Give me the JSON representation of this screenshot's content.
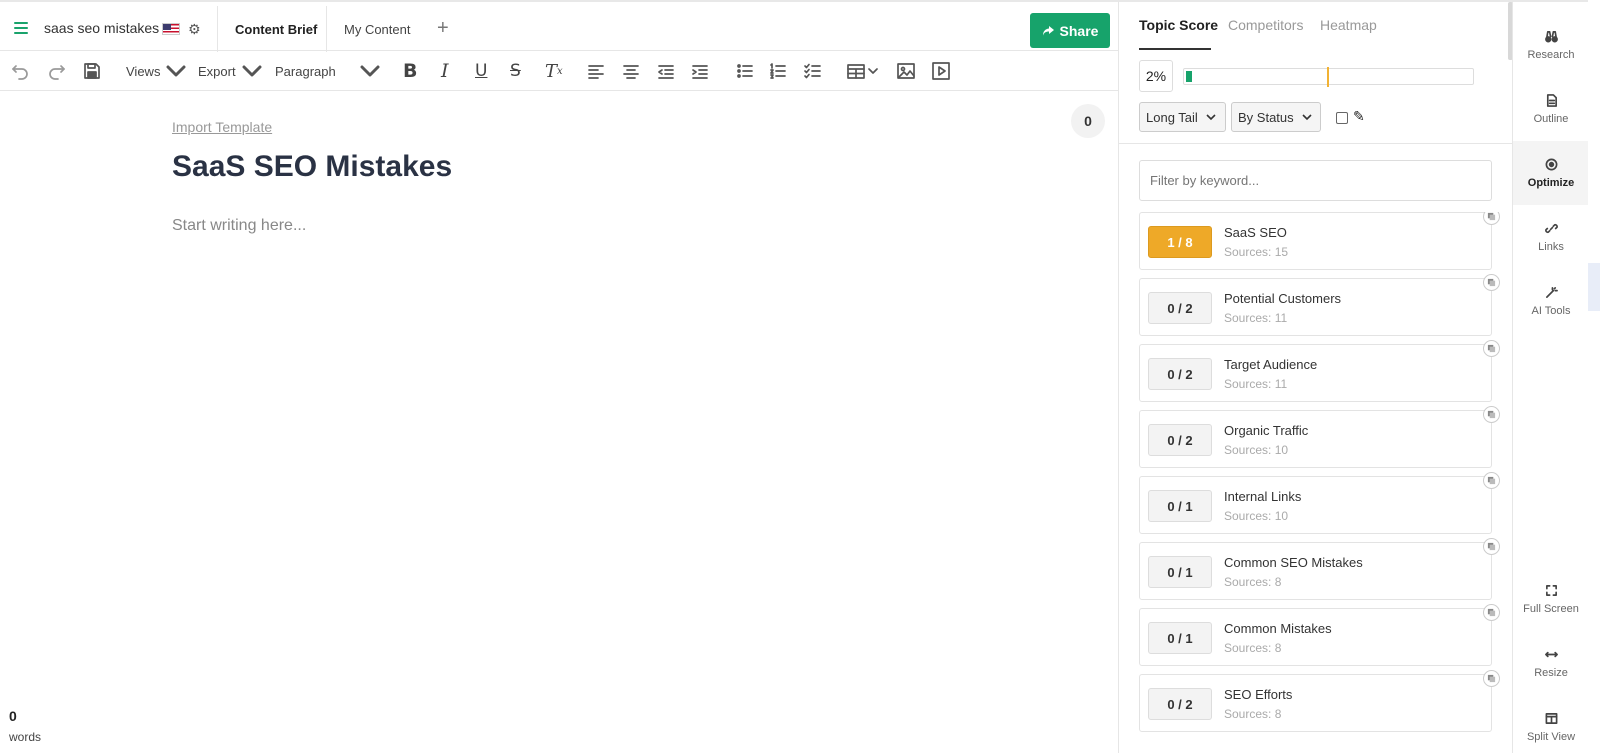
{
  "header": {
    "doc_name": "saas seo mistakes",
    "tabs": [
      {
        "label": "Content Brief",
        "active": true
      },
      {
        "label": "My Content",
        "active": false
      }
    ],
    "share_label": "Share",
    "accent_color": "#17a36b"
  },
  "toolbar": {
    "views_label": "Views",
    "export_label": "Export",
    "paragraph_label": "Paragraph",
    "icons": [
      "undo-icon",
      "redo-icon",
      "save-icon",
      "bold-icon",
      "italic-icon",
      "underline-icon",
      "strikethrough-icon",
      "clear-format-icon",
      "align-left-icon",
      "align-center-icon",
      "outdent-icon",
      "indent-icon",
      "bullet-list-icon",
      "numbered-list-icon",
      "checklist-icon",
      "table-icon",
      "image-icon",
      "video-icon"
    ]
  },
  "editor": {
    "import_template": "Import Template",
    "title": "SaaS SEO Mistakes",
    "placeholder": "Start writing here...",
    "count_bubble": "0",
    "word_count": "0",
    "word_label": "words"
  },
  "panel": {
    "tabs": [
      {
        "label": "Topic Score",
        "active": true
      },
      {
        "label": "Competitors",
        "active": false
      },
      {
        "label": "Heatmap",
        "active": false
      }
    ],
    "score_text": "2%",
    "score_fraction": 0.02,
    "target_fraction": 0.5,
    "filter_select": "Long Tail",
    "status_select": "By Status",
    "filter_placeholder": "Filter by keyword...",
    "topics": [
      {
        "score": "1 / 8",
        "name": "SaaS SEO",
        "sources": "Sources: 15",
        "highlight": true
      },
      {
        "score": "0 / 2",
        "name": "Potential Customers",
        "sources": "Sources: 11",
        "highlight": false
      },
      {
        "score": "0 / 2",
        "name": "Target Audience",
        "sources": "Sources: 11",
        "highlight": false
      },
      {
        "score": "0 / 2",
        "name": "Organic Traffic",
        "sources": "Sources: 10",
        "highlight": false
      },
      {
        "score": "0 / 1",
        "name": "Internal Links",
        "sources": "Sources: 10",
        "highlight": false
      },
      {
        "score": "0 / 1",
        "name": "Common SEO Mistakes",
        "sources": "Sources: 8",
        "highlight": false
      },
      {
        "score": "0 / 1",
        "name": "Common Mistakes",
        "sources": "Sources: 8",
        "highlight": false
      },
      {
        "score": "0 / 2",
        "name": "SEO Efforts",
        "sources": "Sources: 8",
        "highlight": false
      }
    ]
  },
  "rail": {
    "items": [
      {
        "label": "Research",
        "icon": "binoculars-icon",
        "active": false
      },
      {
        "label": "Outline",
        "icon": "document-icon",
        "active": false
      },
      {
        "label": "Optimize",
        "icon": "target-icon",
        "active": true
      },
      {
        "label": "Links",
        "icon": "link-icon",
        "active": false
      },
      {
        "label": "AI Tools",
        "icon": "magic-wand-icon",
        "active": false
      }
    ],
    "bottom_items": [
      {
        "label": "Full Screen",
        "icon": "fullscreen-icon"
      },
      {
        "label": "Resize",
        "icon": "resize-icon"
      },
      {
        "label": "Split View",
        "icon": "split-view-icon"
      }
    ]
  }
}
